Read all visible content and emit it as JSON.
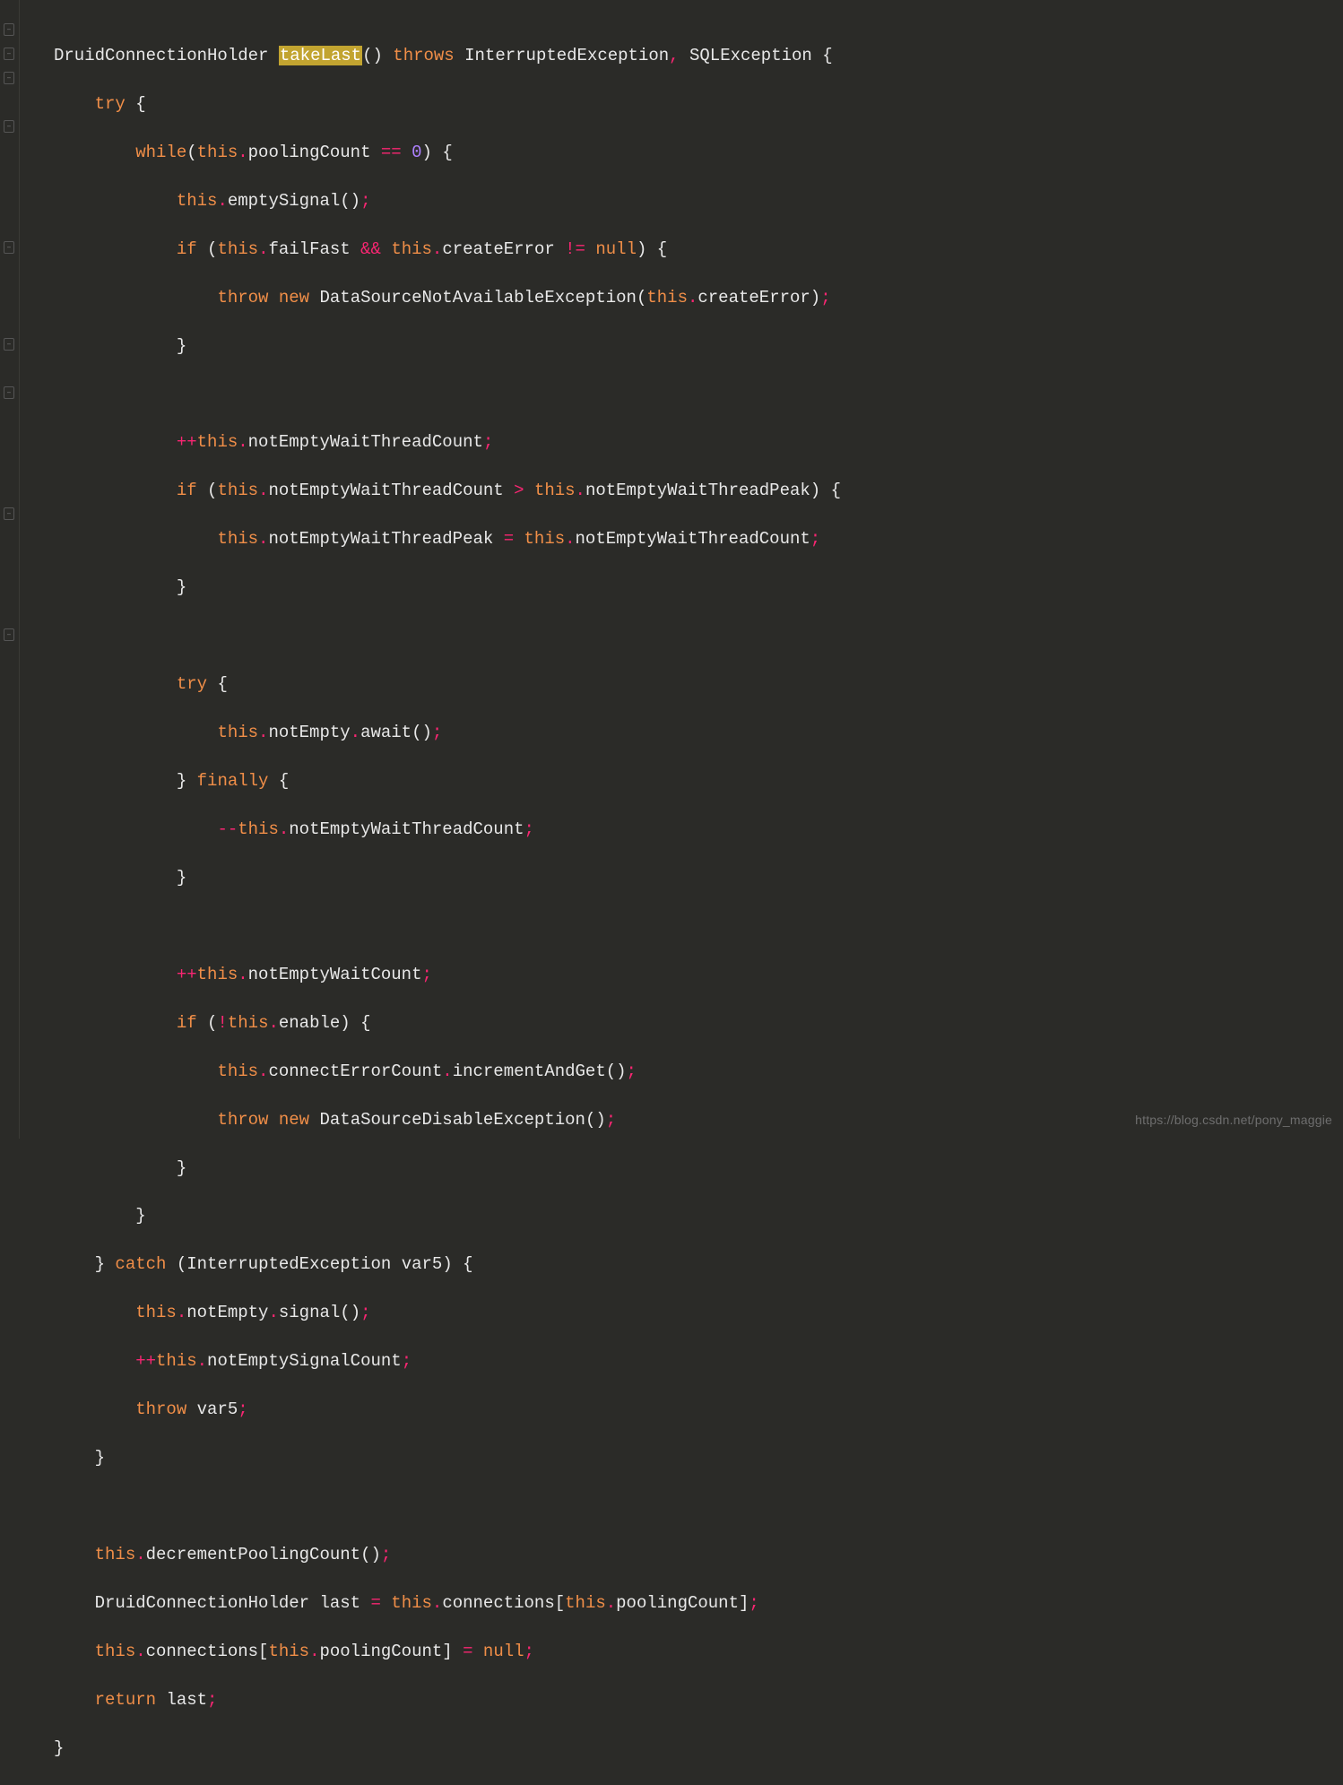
{
  "watermark": "https://blog.csdn.net/pony_maggie",
  "tokens": {
    "kw_try": "try",
    "kw_while": "while",
    "kw_if": "if",
    "kw_throw": "throw",
    "kw_throws": "throws",
    "kw_new": "new",
    "kw_catch": "catch",
    "kw_finally": "finally",
    "kw_return": "return",
    "kw_this": "this",
    "kw_null": "null",
    "num_zero": "0"
  },
  "ids": {
    "DruidConnectionHolder": "DruidConnectionHolder",
    "takeLast": "takeLast",
    "InterruptedException": "InterruptedException",
    "SQLException": "SQLException",
    "poolingCount": "poolingCount",
    "emptySignal": "emptySignal",
    "failFast": "failFast",
    "createError": "createError",
    "DataSourceNotAvailableException": "DataSourceNotAvailableException",
    "notEmptyWaitThreadCount": "notEmptyWaitThreadCount",
    "notEmptyWaitThreadPeak": "notEmptyWaitThreadPeak",
    "notEmpty": "notEmpty",
    "await": "await",
    "notEmptyWaitCount": "notEmptyWaitCount",
    "enable": "enable",
    "connectErrorCount": "connectErrorCount",
    "incrementAndGet": "incrementAndGet",
    "DataSourceDisableException": "DataSourceDisableException",
    "var5": "var5",
    "signal": "signal",
    "notEmptySignalCount": "notEmptySignalCount",
    "decrementPoolingCount": "decrementPoolingCount",
    "last": "last",
    "connections": "connections"
  },
  "ops": {
    "eqeq": "==",
    "andand": "&&",
    "noteq": "!=",
    "gt": ">",
    "assign": "=",
    "inc": "++",
    "dec": "--",
    "not": "!",
    "semi": ";",
    "comma": ",",
    "dot": "."
  },
  "pn": {
    "lparen": "(",
    "rparen": ")",
    "lbrace": "{",
    "rbrace": "}",
    "lbracket": "[",
    "rbracket": "]"
  }
}
